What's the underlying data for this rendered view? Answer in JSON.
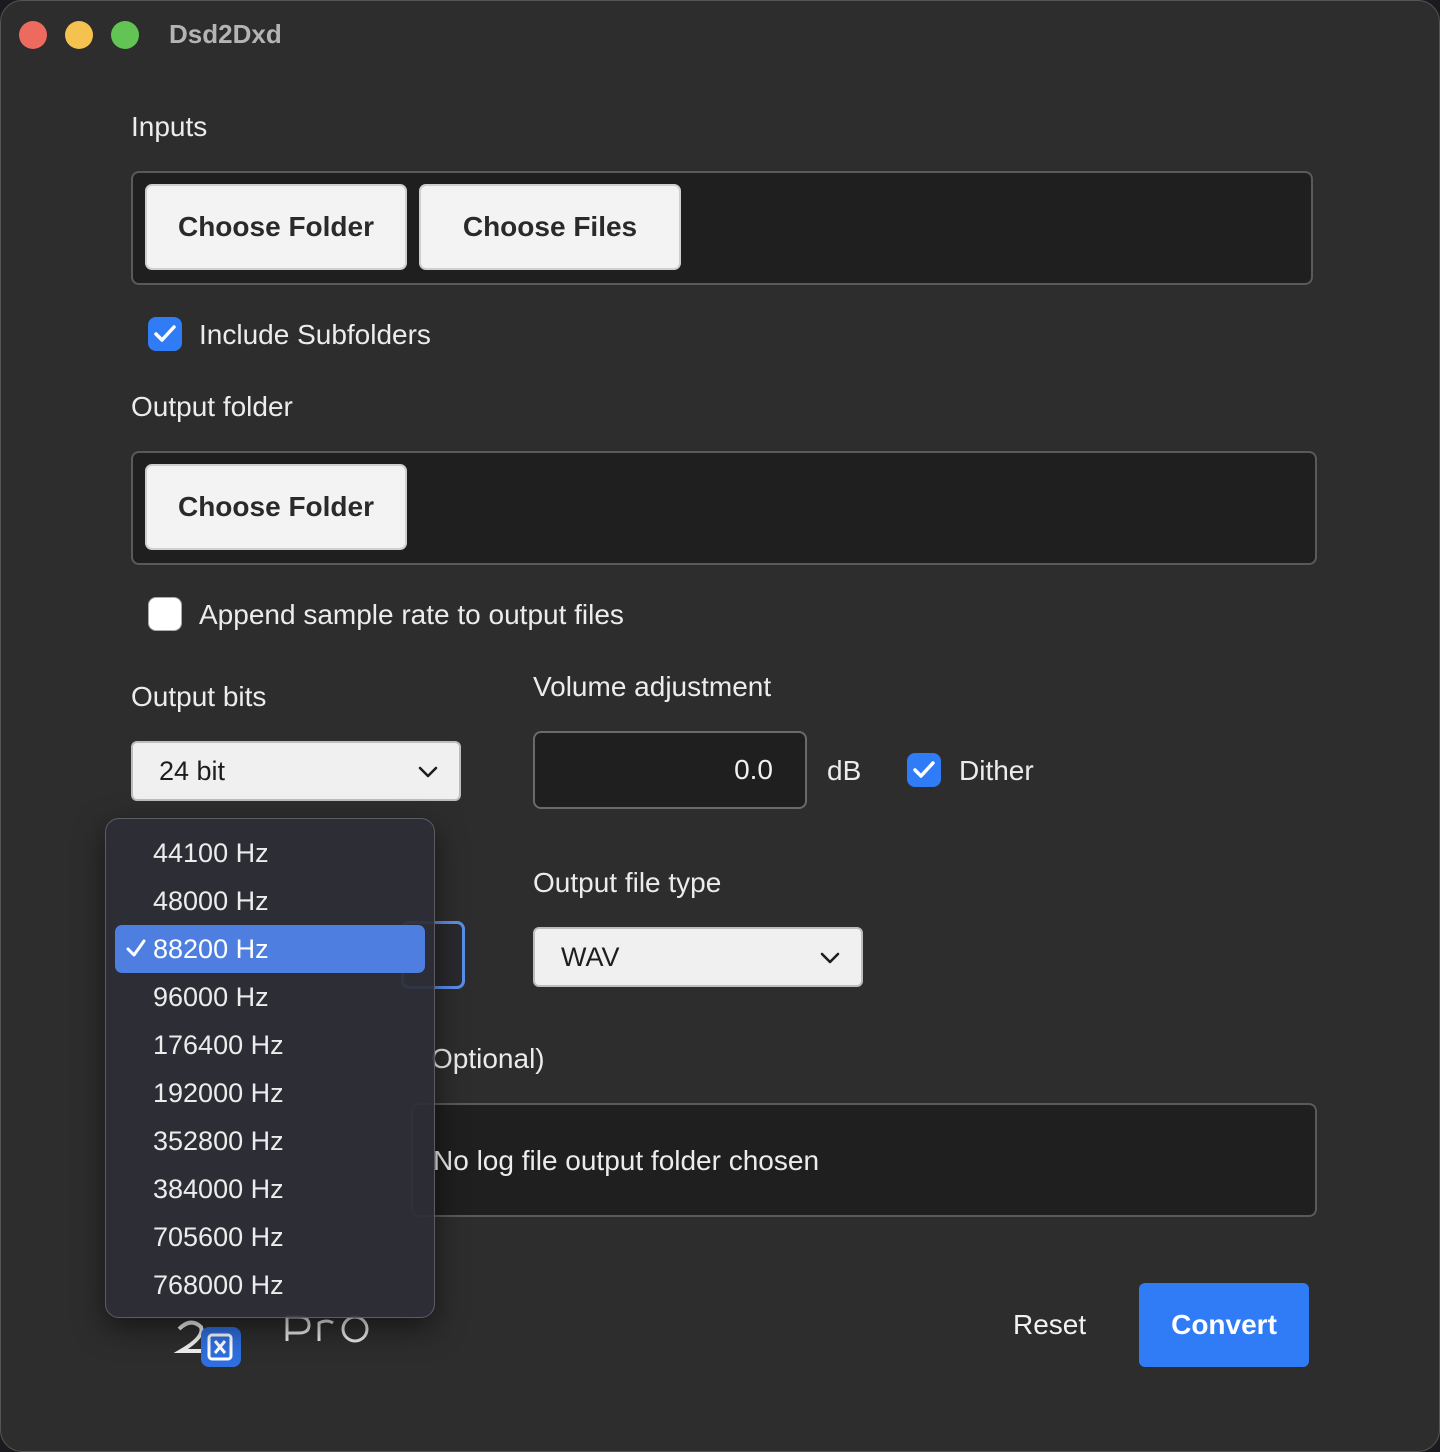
{
  "window": {
    "title": "Dsd2Dxd"
  },
  "inputs": {
    "label": "Inputs",
    "choose_folder": "Choose Folder",
    "choose_files": "Choose Files",
    "include_subfolders": {
      "label": "Include Subfolders",
      "checked": true
    }
  },
  "output_folder": {
    "label": "Output folder",
    "choose_folder": "Choose Folder",
    "append_sample_rate": {
      "label": "Append sample rate to output files",
      "checked": false
    }
  },
  "output_bits": {
    "label": "Output bits",
    "selected": "24 bit"
  },
  "volume": {
    "label": "Volume adjustment",
    "value": "0.0",
    "unit": "dB",
    "dither": {
      "label": "Dither",
      "checked": true
    }
  },
  "output_file_type": {
    "label": "Output file type",
    "selected": "WAV"
  },
  "log": {
    "label_partial": "Optional)",
    "placeholder_partial": "No log file output folder chosen"
  },
  "sample_rate_menu": {
    "items": [
      "44100 Hz",
      "48000 Hz",
      "88200 Hz",
      "96000 Hz",
      "176400 Hz",
      "192000 Hz",
      "352800 Hz",
      "384000 Hz",
      "705600 Hz",
      "768000 Hz"
    ],
    "selected": "88200 Hz"
  },
  "actions": {
    "reset": "Reset",
    "convert": "Convert"
  },
  "colors": {
    "accent": "#2f7cf6",
    "window_bg": "#2d2d2d",
    "selection": "#4e7fe0"
  }
}
